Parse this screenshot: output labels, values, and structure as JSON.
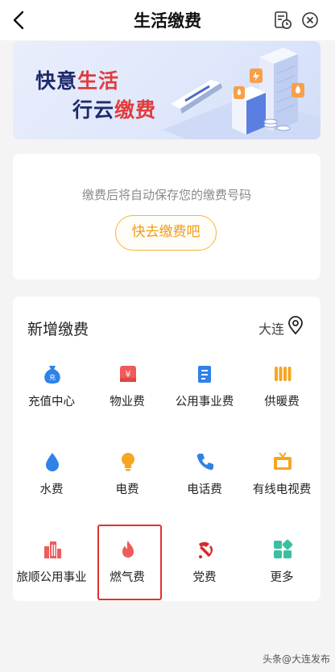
{
  "header": {
    "title": "生活缴费",
    "back_icon": "chevron-left-icon",
    "history_icon": "bill-history-icon",
    "close_icon": "close-circle-icon"
  },
  "banner": {
    "line1_a": "快意",
    "line1_b": "生活",
    "line2_a": "行云",
    "line2_b": "缴费"
  },
  "save_card": {
    "hint": "缴费后将自动保存您的缴费号码",
    "button": "快去缴费吧"
  },
  "grid": {
    "title": "新增缴费",
    "city": "大连",
    "items": [
      {
        "label": "充值中心",
        "icon": "recharge-bag-icon",
        "color": "#2e82e8"
      },
      {
        "label": "物业费",
        "icon": "property-fee-icon",
        "color": "#ef5b5b"
      },
      {
        "label": "公用事业费",
        "icon": "utility-doc-icon",
        "color": "#2e82e8"
      },
      {
        "label": "供暖费",
        "icon": "radiator-icon",
        "color": "#f5a623"
      },
      {
        "label": "水费",
        "icon": "water-drop-icon",
        "color": "#2e82e8"
      },
      {
        "label": "电费",
        "icon": "light-bulb-icon",
        "color": "#f5a623"
      },
      {
        "label": "电话费",
        "icon": "phone-icon",
        "color": "#2e82e8"
      },
      {
        "label": "有线电视费",
        "icon": "tv-icon",
        "color": "#f5a623"
      },
      {
        "label": "旅顺公用事业",
        "icon": "building-icon",
        "color": "#ef5b5b"
      },
      {
        "label": "燃气费",
        "icon": "flame-icon",
        "color": "#ef5b5b"
      },
      {
        "label": "党费",
        "icon": "party-emblem-icon",
        "color": "#d8282a"
      },
      {
        "label": "更多",
        "icon": "more-grid-icon",
        "color": "#3cbfa0"
      }
    ]
  },
  "watermark": "头条@大连发布"
}
